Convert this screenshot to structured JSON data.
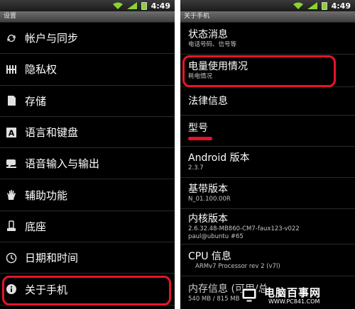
{
  "status_bar": {
    "time": "4:49"
  },
  "left_screen": {
    "title": "设置",
    "items": [
      {
        "label": "帐户与同步",
        "icon": "sync-icon"
      },
      {
        "label": "隐私权",
        "icon": "privacy-grid-icon"
      },
      {
        "label": "存储",
        "icon": "sd-card-icon"
      },
      {
        "label": "语言和键盘",
        "icon": "keyboard-a-icon"
      },
      {
        "label": "语音输入与输出",
        "icon": "voice-bubble-icon"
      },
      {
        "label": "辅助功能",
        "icon": "hand-icon"
      },
      {
        "label": "底座",
        "icon": "dock-icon"
      },
      {
        "label": "日期和时间",
        "icon": "clock-icon"
      },
      {
        "label": "关于手机",
        "icon": "info-icon"
      }
    ]
  },
  "right_screen": {
    "title": "关于手机",
    "items": [
      {
        "title": "状态消息",
        "subtitle": "电话号码、信号等"
      },
      {
        "title": "电量使用情况",
        "subtitle": "耗电情况"
      },
      {
        "title": "法律信息",
        "subtitle": ""
      },
      {
        "title": "型号",
        "subtitle": ""
      },
      {
        "title": "Android 版本",
        "subtitle": "2.3.7"
      },
      {
        "title": "基带版本",
        "subtitle": "N_01.100.00R"
      },
      {
        "title": "内核版本",
        "subtitle": "2.6.32.48-MB860-CM7-faux123-v022",
        "subtitle2": "paul@ubuntu #65"
      },
      {
        "title": "CPU 信息",
        "subtitle": "ARMv7 Processor rev 2 (v7l)"
      },
      {
        "title": "内存信息 (可用/总",
        "subtitle": "540 MB / 815 MB"
      }
    ]
  },
  "watermark": {
    "text": "电脑百事网",
    "url": "WWW.PC841.COM"
  },
  "colors": {
    "highlight": "#e8132a",
    "background": "#000000"
  }
}
